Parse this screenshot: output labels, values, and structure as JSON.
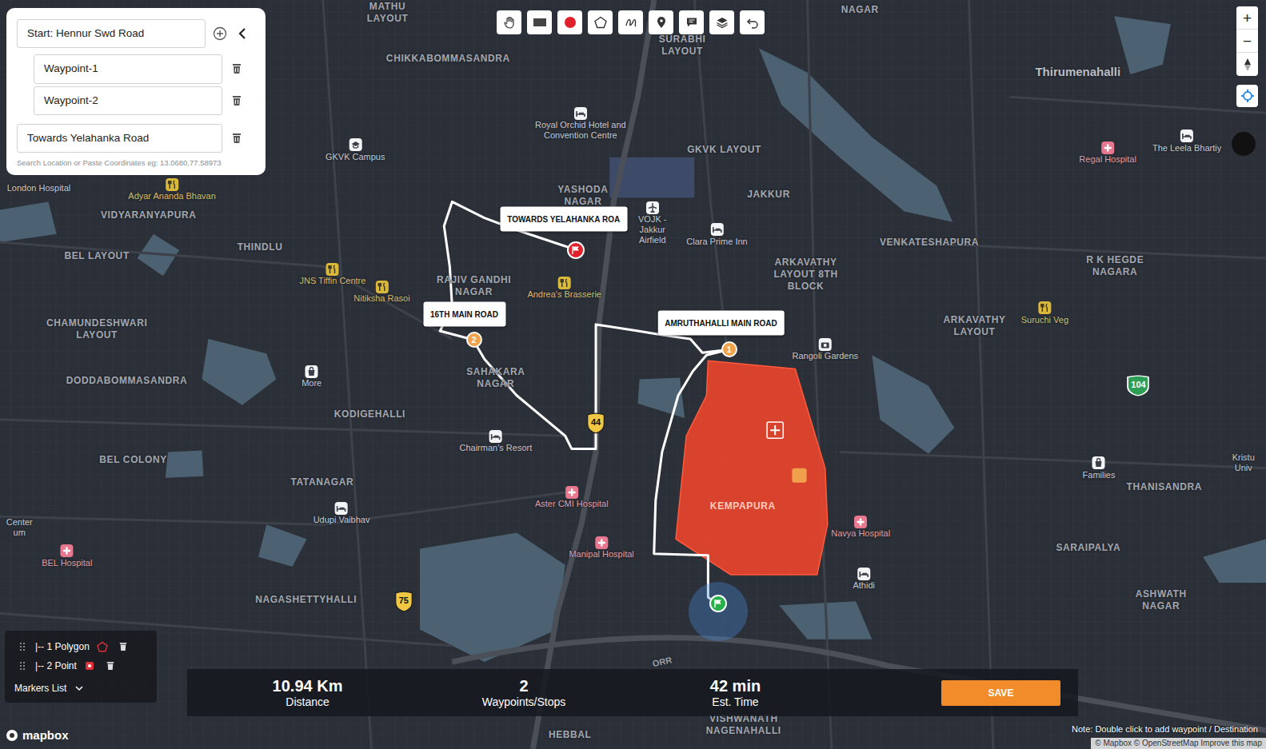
{
  "route_panel": {
    "start": "Start: Hennur Swd Road",
    "waypoints": [
      "Waypoint-1",
      "Waypoint-2"
    ],
    "destination": "Towards Yelahanka Road",
    "hint": "Search Location or Paste Coordinates eg: 13.0680,77.58973"
  },
  "zoom_controls": {
    "zoom_in": "+",
    "zoom_out": "−"
  },
  "map": {
    "labels": [
      {
        "text": "MATHU LAYOUT",
        "kind": "area"
      },
      {
        "text": "CHIKKABOMMASANDRA",
        "kind": "area"
      },
      {
        "text": "SURABHI LAYOUT",
        "kind": "area"
      },
      {
        "text": "NAGAR",
        "kind": "area"
      },
      {
        "text": "Royal Orchid Hotel and Convention Centre",
        "kind": "hotel"
      },
      {
        "text": "GKVK Campus",
        "kind": "campus"
      },
      {
        "text": "GKVK LAYOUT",
        "kind": "area"
      },
      {
        "text": "London Hospital",
        "kind": "text"
      },
      {
        "text": "Adyar Ananda Bhavan",
        "kind": "food"
      },
      {
        "text": "VIDYARANYAPURA",
        "kind": "area"
      },
      {
        "text": "YASHODA NAGAR",
        "kind": "area"
      },
      {
        "text": "VOJK - Jakkur Airfield",
        "kind": "airport"
      },
      {
        "text": "Clara Prime Inn",
        "kind": "hotel"
      },
      {
        "text": "JAKKUR",
        "kind": "area"
      },
      {
        "text": "Thirumenahalli",
        "kind": "town"
      },
      {
        "text": "Regal Hospital",
        "kind": "hospital"
      },
      {
        "text": "The Leela Bhartiy",
        "kind": "hotel"
      },
      {
        "text": "BEL LAYOUT",
        "kind": "area"
      },
      {
        "text": "THINDLU",
        "kind": "area"
      },
      {
        "text": "JNS Tiffin Centre",
        "kind": "food"
      },
      {
        "text": "Nitiksha Rasoi",
        "kind": "food"
      },
      {
        "text": "RAJIV GANDHI NAGAR",
        "kind": "area"
      },
      {
        "text": "Andrea's Brasserie",
        "kind": "food"
      },
      {
        "text": "VENKATESHAPURA",
        "kind": "area"
      },
      {
        "text": "ARKAVATHY LAYOUT 8TH BLOCK",
        "kind": "area"
      },
      {
        "text": "R K HEGDE NAGARA",
        "kind": "area"
      },
      {
        "text": "CHAMUNDESHWARI LAYOUT",
        "kind": "area"
      },
      {
        "text": "SAHAKARA NAGAR",
        "kind": "area"
      },
      {
        "text": "Rangoli Gardens",
        "kind": "camera"
      },
      {
        "text": "ARKAVATHY LAYOUT",
        "kind": "area"
      },
      {
        "text": "Suruchi Veg",
        "kind": "food"
      },
      {
        "text": "DODDABOMMASANDRA",
        "kind": "area"
      },
      {
        "text": "More",
        "kind": "shop"
      },
      {
        "text": "KODIGEHALLI",
        "kind": "area"
      },
      {
        "text": "Chairman's Resort",
        "kind": "hotel"
      },
      {
        "text": "104",
        "kind": "shield-green"
      },
      {
        "text": "44",
        "kind": "shield"
      },
      {
        "text": "BEL COLONY",
        "kind": "area"
      },
      {
        "text": "TATANAGAR",
        "kind": "area"
      },
      {
        "text": "Families",
        "kind": "shop"
      },
      {
        "text": "THANISANDRA",
        "kind": "area"
      },
      {
        "text": "Kristu Univ",
        "kind": "text"
      },
      {
        "text": "KEMPAPURA",
        "kind": "area"
      },
      {
        "text": "Aster CMI Hospital",
        "kind": "hospital"
      },
      {
        "text": "Udupi Vaibhav",
        "kind": "hotel"
      },
      {
        "text": "Center um",
        "kind": "text"
      },
      {
        "text": "Navya Hospital",
        "kind": "hospital"
      },
      {
        "text": "SARAIPALYA",
        "kind": "area"
      },
      {
        "text": "Manipal Hospital",
        "kind": "hospital"
      },
      {
        "text": "BEL Hospital",
        "kind": "hospital"
      },
      {
        "text": "Athidi",
        "kind": "hotel"
      },
      {
        "text": "NAGASHETTYHALLI",
        "kind": "area"
      },
      {
        "text": "75",
        "kind": "shield"
      },
      {
        "text": "ASHWATH NAGAR",
        "kind": "area"
      },
      {
        "text": "ORR",
        "kind": "road"
      },
      {
        "text": "VISHWANATH NAGENAHALLI",
        "kind": "area"
      },
      {
        "text": "HEBBAL",
        "kind": "area"
      }
    ],
    "callouts": [
      "TOWARDS YELAHANKA ROA",
      "16TH MAIN ROAD",
      "AMRUTHAHALLI MAIN ROAD"
    ],
    "waypoint_markers": [
      "1",
      "2"
    ]
  },
  "layers": {
    "items": [
      {
        "label": "|-- 1 Polygon",
        "kind": "polygon"
      },
      {
        "label": "|-- 2 Point",
        "kind": "point"
      }
    ],
    "title": "Markers List"
  },
  "stats": [
    {
      "value": "10.94 Km",
      "label": "Distance"
    },
    {
      "value": "2",
      "label": "Waypoints/Stops"
    },
    {
      "value": "42 min",
      "label": "Est. Time"
    }
  ],
  "save_button": "SAVE",
  "note": "Note: Double click to add waypoint / Destination",
  "attribution": "© Mapbox © OpenStreetMap Improve this map",
  "logo": "mapbox"
}
